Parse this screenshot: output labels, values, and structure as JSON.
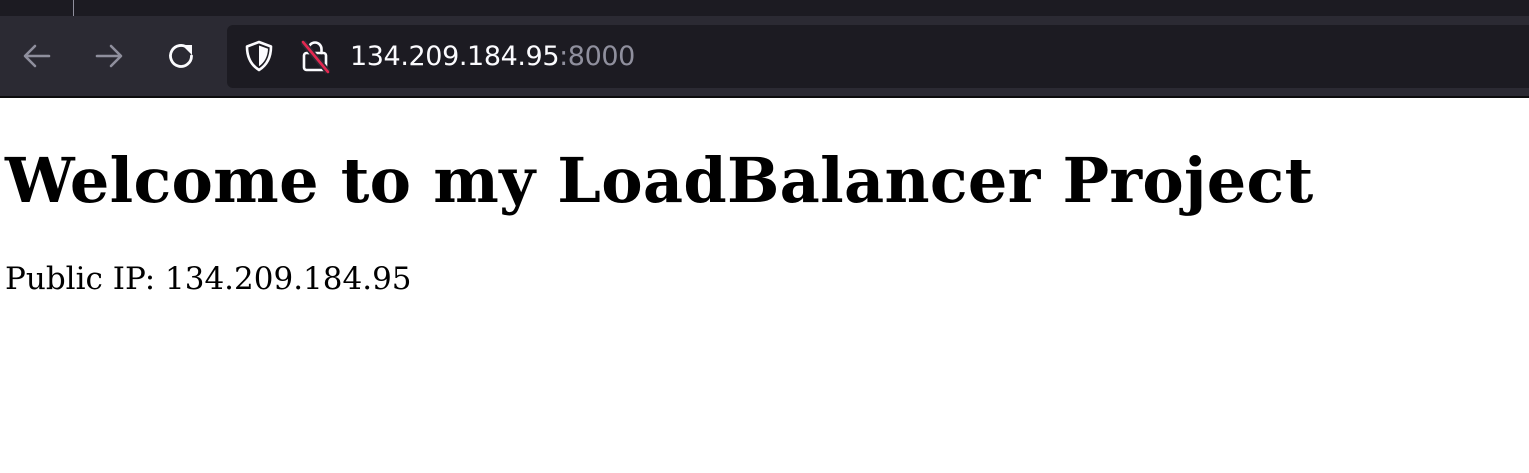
{
  "browser": {
    "toolbar": {
      "back": {
        "icon": "back-arrow-icon",
        "enabled": false
      },
      "forward": {
        "icon": "forward-arrow-icon",
        "enabled": false
      },
      "reload": {
        "icon": "reload-icon"
      }
    },
    "urlbar": {
      "host": "134.209.184.95",
      "port": ":8000",
      "icons": [
        "tracking-protection-shield-icon",
        "insecure-lock-icon"
      ]
    },
    "colors": {
      "chrome_bg": "#2b2a33",
      "urlbar_bg": "#1c1b22",
      "text": "#fbfbfe",
      "muted": "#8f8f9d",
      "insecure_strike": "#e22850"
    }
  },
  "page": {
    "heading": "Welcome to my LoadBalancer Project",
    "public_ip_line": "Public IP: 134.209.184.95"
  }
}
